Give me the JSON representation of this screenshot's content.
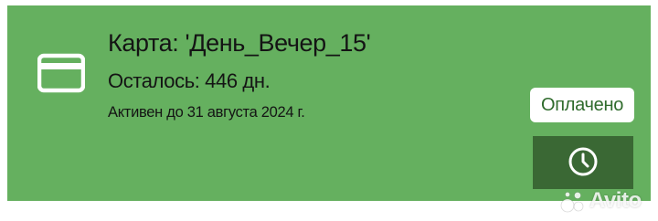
{
  "colors": {
    "card_background": "#65b05f",
    "history_button": "#3a6834",
    "badge_background": "#ffffff",
    "badge_text": "#2f6b2c",
    "text": "#141414"
  },
  "card": {
    "icon": "credit-card-icon",
    "title": "Карта: 'День_Вечер_15'",
    "remaining": "Осталось: 446 дн.",
    "active_until": "Активен до 31 августа 2024 г.",
    "status_badge": "Оплачено",
    "history_button_icon": "clock-icon"
  },
  "watermark": {
    "text": "Avito"
  }
}
